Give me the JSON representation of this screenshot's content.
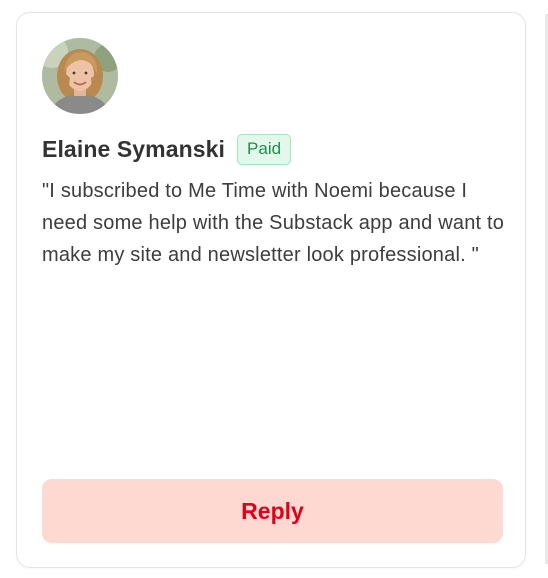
{
  "comment": {
    "author": "Elaine Symanski",
    "badge": "Paid",
    "text": "\"I subscribed to Me Time with Noemi because I need some help with the Substack app and want to make my site and newsletter look professional. \"",
    "reply_label": "Reply",
    "avatar_icon": "user-avatar-photo"
  },
  "colors": {
    "badge_text": "#1e8f4e",
    "badge_bg": "#e3f7ea",
    "reply_text": "#e0001a",
    "reply_bg": "#fdd9d2"
  }
}
